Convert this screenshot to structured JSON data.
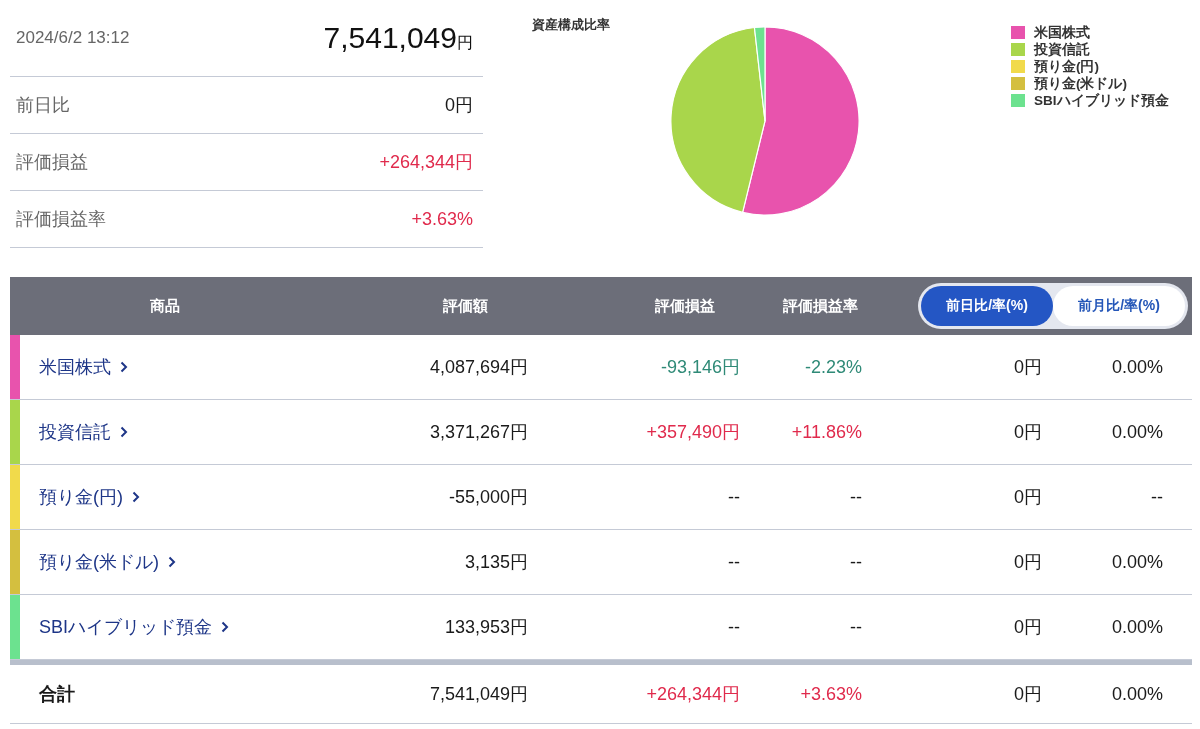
{
  "summary": {
    "datetime": "2024/6/2 13:12",
    "total": "7,541,049",
    "total_unit": "円",
    "rows": [
      {
        "label": "前日比",
        "value": "0円",
        "color": "#1a1a1a"
      },
      {
        "label": "評価損益",
        "value": "+264,344円",
        "color": "#e02a4c"
      },
      {
        "label": "評価損益率",
        "value": "+3.63%",
        "color": "#e02a4c"
      }
    ]
  },
  "chart": {
    "title": "資産構成比率",
    "legend": [
      {
        "label": "米国株式",
        "color": "#e853ad"
      },
      {
        "label": "投資信託",
        "color": "#a9d64b"
      },
      {
        "label": "預り金(円)",
        "color": "#f1da4b"
      },
      {
        "label": "預り金(米ドル)",
        "color": "#d4bf3f"
      },
      {
        "label": "SBIハイブリッド預金",
        "color": "#6ce28f"
      }
    ]
  },
  "table": {
    "columns": [
      "商品",
      "評価額",
      "評価損益",
      "評価損益率"
    ],
    "toggle": [
      {
        "label": "前日比/率(%)",
        "selected": true
      },
      {
        "label": "前月比/率(%)",
        "selected": false
      }
    ],
    "rows": [
      {
        "name": "米国株式",
        "color": "#e853ad",
        "value": "4,087,694円",
        "gain": {
          "value": "-93,146円",
          "color": "#2f8a77"
        },
        "rate": {
          "value": "-2.23%",
          "color": "#2f8a77"
        },
        "change": "0円",
        "change_rate": "0.00%"
      },
      {
        "name": "投資信託",
        "color": "#a9d64b",
        "value": "3,371,267円",
        "gain": {
          "value": "+357,490円",
          "color": "#e02a4c"
        },
        "rate": {
          "value": "+11.86%",
          "color": "#e02a4c"
        },
        "change": "0円",
        "change_rate": "0.00%"
      },
      {
        "name": "預り金(円)",
        "color": "#f1da4b",
        "value": "-55,000円",
        "gain": {
          "value": "--",
          "color": "#1a1a1a"
        },
        "rate": {
          "value": "--",
          "color": "#1a1a1a"
        },
        "change": "0円",
        "change_rate": "--"
      },
      {
        "name": "預り金(米ドル)",
        "color": "#d4bf3f",
        "value": "3,135円",
        "gain": {
          "value": "--",
          "color": "#1a1a1a"
        },
        "rate": {
          "value": "--",
          "color": "#1a1a1a"
        },
        "change": "0円",
        "change_rate": "0.00%"
      },
      {
        "name": "SBIハイブリッド預金",
        "color": "#6ce28f",
        "value": "133,953円",
        "gain": {
          "value": "--",
          "color": "#1a1a1a"
        },
        "rate": {
          "value": "--",
          "color": "#1a1a1a"
        },
        "change": "0円",
        "change_rate": "0.00%"
      }
    ],
    "total": {
      "label": "合計",
      "value": "7,541,049円",
      "gain": {
        "value": "+264,344円",
        "color": "#e02a4c"
      },
      "rate": {
        "value": "+3.63%",
        "color": "#e02a4c"
      },
      "change": "0円",
      "change_rate": "0.00%"
    }
  }
}
